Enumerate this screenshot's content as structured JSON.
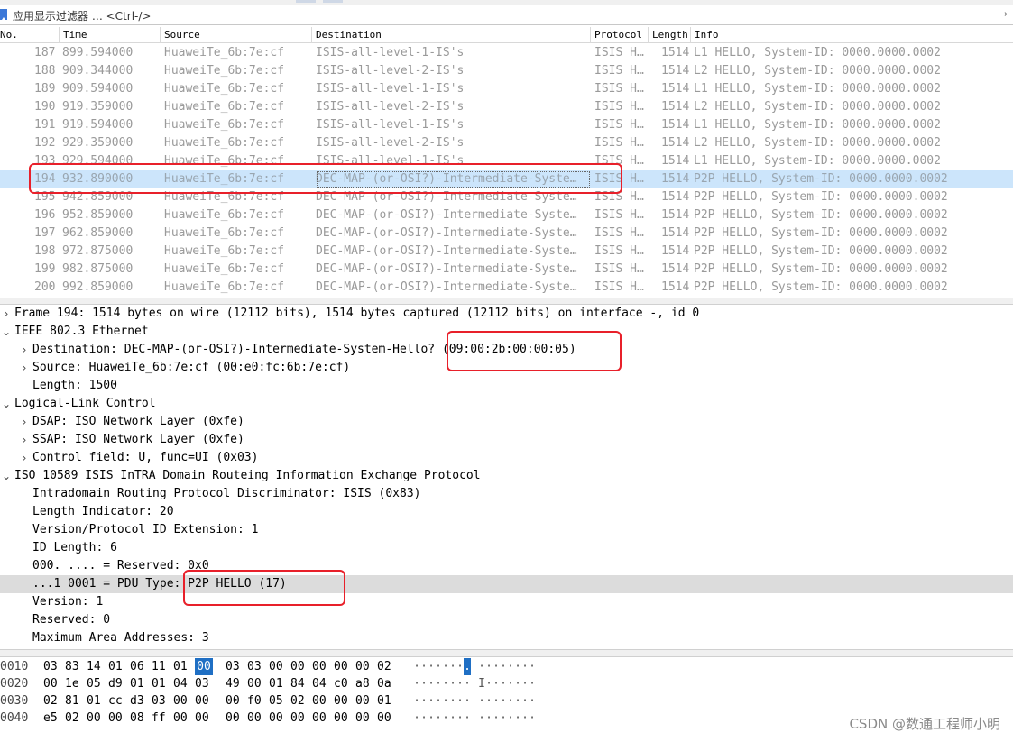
{
  "filter": {
    "placeholder": "应用显示过滤器 … <Ctrl-/>",
    "dropdown_icon": "arrow-right-icon"
  },
  "columns": [
    "No.",
    "Time",
    "Source",
    "Destination",
    "Protocol",
    "Length",
    "Info"
  ],
  "packets": [
    {
      "no": "187",
      "time": "899.594000",
      "src": "HuaweiTe_6b:7e:cf",
      "dst": "ISIS-all-level-1-IS's",
      "proto": "ISIS H…",
      "len": "1514",
      "info": "L1 HELLO, System-ID: 0000.0000.0002"
    },
    {
      "no": "188",
      "time": "909.344000",
      "src": "HuaweiTe_6b:7e:cf",
      "dst": "ISIS-all-level-2-IS's",
      "proto": "ISIS H…",
      "len": "1514",
      "info": "L2 HELLO, System-ID: 0000.0000.0002"
    },
    {
      "no": "189",
      "time": "909.594000",
      "src": "HuaweiTe_6b:7e:cf",
      "dst": "ISIS-all-level-1-IS's",
      "proto": "ISIS H…",
      "len": "1514",
      "info": "L1 HELLO, System-ID: 0000.0000.0002"
    },
    {
      "no": "190",
      "time": "919.359000",
      "src": "HuaweiTe_6b:7e:cf",
      "dst": "ISIS-all-level-2-IS's",
      "proto": "ISIS H…",
      "len": "1514",
      "info": "L2 HELLO, System-ID: 0000.0000.0002"
    },
    {
      "no": "191",
      "time": "919.594000",
      "src": "HuaweiTe_6b:7e:cf",
      "dst": "ISIS-all-level-1-IS's",
      "proto": "ISIS H…",
      "len": "1514",
      "info": "L1 HELLO, System-ID: 0000.0000.0002"
    },
    {
      "no": "192",
      "time": "929.359000",
      "src": "HuaweiTe_6b:7e:cf",
      "dst": "ISIS-all-level-2-IS's",
      "proto": "ISIS H…",
      "len": "1514",
      "info": "L2 HELLO, System-ID: 0000.0000.0002"
    },
    {
      "no": "193",
      "time": "929.594000",
      "src": "HuaweiTe_6b:7e:cf",
      "dst": "ISIS-all-level-1-IS's",
      "proto": "ISIS H…",
      "len": "1514",
      "info": "L1 HELLO, System-ID: 0000.0000.0002"
    },
    {
      "no": "194",
      "time": "932.890000",
      "src": "HuaweiTe_6b:7e:cf",
      "dst": "DEC-MAP-(or-OSI?)-Intermediate-Syste…",
      "proto": "ISIS H…",
      "len": "1514",
      "info": "P2P HELLO, System-ID: 0000.0000.0002",
      "selected": true
    },
    {
      "no": "195",
      "time": "942.859000",
      "src": "HuaweiTe_6b:7e:cf",
      "dst": "DEC-MAP-(or-OSI?)-Intermediate-Syste…",
      "proto": "ISIS H…",
      "len": "1514",
      "info": "P2P HELLO, System-ID: 0000.0000.0002"
    },
    {
      "no": "196",
      "time": "952.859000",
      "src": "HuaweiTe_6b:7e:cf",
      "dst": "DEC-MAP-(or-OSI?)-Intermediate-Syste…",
      "proto": "ISIS H…",
      "len": "1514",
      "info": "P2P HELLO, System-ID: 0000.0000.0002"
    },
    {
      "no": "197",
      "time": "962.859000",
      "src": "HuaweiTe_6b:7e:cf",
      "dst": "DEC-MAP-(or-OSI?)-Intermediate-Syste…",
      "proto": "ISIS H…",
      "len": "1514",
      "info": "P2P HELLO, System-ID: 0000.0000.0002"
    },
    {
      "no": "198",
      "time": "972.875000",
      "src": "HuaweiTe_6b:7e:cf",
      "dst": "DEC-MAP-(or-OSI?)-Intermediate-Syste…",
      "proto": "ISIS H…",
      "len": "1514",
      "info": "P2P HELLO, System-ID: 0000.0000.0002"
    },
    {
      "no": "199",
      "time": "982.875000",
      "src": "HuaweiTe_6b:7e:cf",
      "dst": "DEC-MAP-(or-OSI?)-Intermediate-Syste…",
      "proto": "ISIS H…",
      "len": "1514",
      "info": "P2P HELLO, System-ID: 0000.0000.0002"
    },
    {
      "no": "200",
      "time": "992.859000",
      "src": "HuaweiTe_6b:7e:cf",
      "dst": "DEC-MAP-(or-OSI?)-Intermediate-Syste…",
      "proto": "ISIS H…",
      "len": "1514",
      "info": "P2P HELLO, System-ID: 0000.0000.0002"
    }
  ],
  "details": [
    {
      "level": 0,
      "toggle": "collapsed",
      "text": "Frame 194: 1514 bytes on wire (12112 bits), 1514 bytes captured (12112 bits) on interface -, id 0"
    },
    {
      "level": 0,
      "toggle": "expanded",
      "text": "IEEE 802.3 Ethernet"
    },
    {
      "level": 1,
      "toggle": "collapsed",
      "text": "Destination: DEC-MAP-(or-OSI?)-Intermediate-System-Hello? (09:00:2b:00:00:05)"
    },
    {
      "level": 1,
      "toggle": "collapsed",
      "text": "Source: HuaweiTe_6b:7e:cf (00:e0:fc:6b:7e:cf)"
    },
    {
      "level": 1,
      "toggle": "none",
      "text": "Length: 1500"
    },
    {
      "level": 0,
      "toggle": "expanded",
      "text": "Logical-Link Control"
    },
    {
      "level": 1,
      "toggle": "collapsed",
      "text": "DSAP: ISO Network Layer (0xfe)"
    },
    {
      "level": 1,
      "toggle": "collapsed",
      "text": "SSAP: ISO Network Layer (0xfe)"
    },
    {
      "level": 1,
      "toggle": "collapsed",
      "text": "Control field: U, func=UI (0x03)"
    },
    {
      "level": 0,
      "toggle": "expanded",
      "text": "ISO 10589 ISIS InTRA Domain Routeing Information Exchange Protocol"
    },
    {
      "level": 1,
      "toggle": "none",
      "text": "Intradomain Routing Protocol Discriminator: ISIS (0x83)"
    },
    {
      "level": 1,
      "toggle": "none",
      "text": "Length Indicator: 20"
    },
    {
      "level": 1,
      "toggle": "none",
      "text": "Version/Protocol ID Extension: 1"
    },
    {
      "level": 1,
      "toggle": "none",
      "text": "ID Length: 6"
    },
    {
      "level": 1,
      "toggle": "none",
      "text": "000. .... = Reserved: 0x0"
    },
    {
      "level": 1,
      "toggle": "none",
      "text": "...1 0001 = PDU Type: P2P HELLO (17)",
      "highlighted": true
    },
    {
      "level": 1,
      "toggle": "none",
      "text": "Version: 1"
    },
    {
      "level": 1,
      "toggle": "none",
      "text": "Reserved: 0"
    },
    {
      "level": 1,
      "toggle": "none",
      "text": "Maximum Area Addresses: 3"
    }
  ],
  "bytes": [
    {
      "offset": "0010",
      "hex": [
        "03",
        "83",
        "14",
        "01",
        "06",
        "11",
        "01",
        "00",
        "03",
        "03",
        "00",
        "00",
        "00",
        "00",
        "00",
        "02"
      ],
      "ascii": "·······.········",
      "selected_index": 7
    },
    {
      "offset": "0020",
      "hex": [
        "00",
        "1e",
        "05",
        "d9",
        "01",
        "01",
        "04",
        "03",
        "49",
        "00",
        "01",
        "84",
        "04",
        "c0",
        "a8",
        "0a"
      ],
      "ascii": "········I·······",
      "selected_index": -1
    },
    {
      "offset": "0030",
      "hex": [
        "02",
        "81",
        "01",
        "cc",
        "d3",
        "03",
        "00",
        "00",
        "00",
        "f0",
        "05",
        "02",
        "00",
        "00",
        "00",
        "01"
      ],
      "ascii": "················",
      "selected_index": -1
    },
    {
      "offset": "0040",
      "hex": [
        "e5",
        "02",
        "00",
        "00",
        "08",
        "ff",
        "00",
        "00",
        "00",
        "00",
        "00",
        "00",
        "00",
        "00",
        "00",
        "00"
      ],
      "ascii": "················",
      "selected_index": -1
    }
  ],
  "watermark": "CSDN @数通工程师小明",
  "colors": {
    "selected_row": "#cce5fb",
    "annotation": "#e8202a",
    "highlight": "#dcdcdc",
    "byte_select": "#1f6fc4"
  }
}
